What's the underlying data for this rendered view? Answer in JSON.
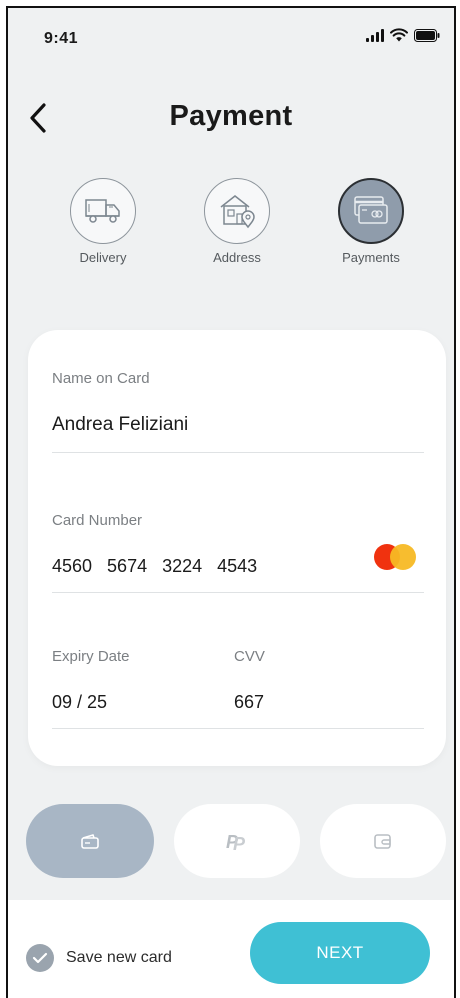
{
  "status_bar": {
    "time": "9:41"
  },
  "header": {
    "title": "Payment"
  },
  "steps": [
    {
      "label": "Delivery",
      "icon": "truck-icon"
    },
    {
      "label": "Address",
      "icon": "house-location-icon"
    },
    {
      "label": "Payments",
      "icon": "cards-icon",
      "active": true
    }
  ],
  "form": {
    "name_label": "Name on Card",
    "name_value": "Andrea Feliziani",
    "number_label": "Card Number",
    "number_value": "4560   5674   3224   4543",
    "expiry_label": "Expiry Date",
    "expiry_value": "09 / 25",
    "cvv_label": "CVV",
    "cvv_value": "667",
    "card_brand": "mastercard"
  },
  "payment_methods": [
    {
      "name": "card",
      "icon": "card-icon",
      "active": true
    },
    {
      "name": "paypal",
      "icon": "paypal-icon",
      "active": false
    },
    {
      "name": "wallet",
      "icon": "wallet-icon",
      "active": false
    }
  ],
  "footer": {
    "save_label": "Save new card",
    "save_checked": true,
    "next_label": "NEXT"
  },
  "colors": {
    "accent": "#3fc0d4",
    "active_method": "#a8b6c5",
    "background": "#eff1f2",
    "mc_red": "#f0320f",
    "mc_yellow": "#f7b924"
  }
}
